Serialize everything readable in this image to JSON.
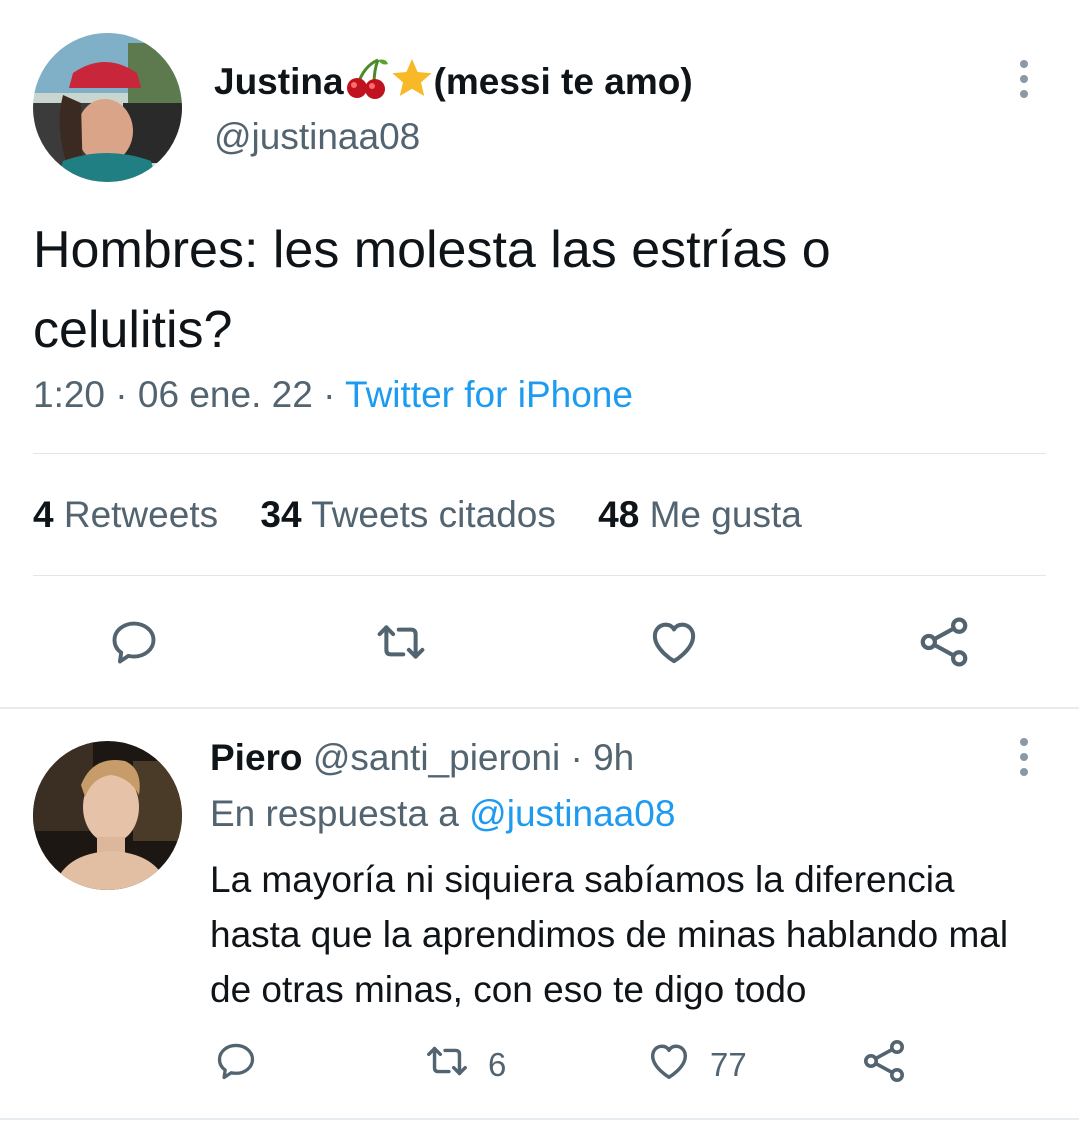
{
  "main_tweet": {
    "display_name": "Justina",
    "display_name_suffix": "(messi te amo)",
    "display_name_icons": [
      "cherries-emoji",
      "star-emoji"
    ],
    "handle": "@justinaa08",
    "text": "Hombres: les molesta las estrías o celulitis?",
    "time": "1:20",
    "date": "06 ene. 22",
    "source": "Twitter for iPhone",
    "stats": {
      "retweets_count": "4",
      "retweets_label": "Retweets",
      "quotes_count": "34",
      "quotes_label": "Tweets citados",
      "likes_count": "48",
      "likes_label": "Me gusta"
    },
    "actions": [
      "reply-icon",
      "retweet-icon",
      "like-icon",
      "share-icon"
    ]
  },
  "reply_tweet": {
    "display_name": "Piero",
    "handle": "@santi_pieroni",
    "time": "9h",
    "reply_prefix": "En respuesta a",
    "reply_mention": "@justinaa08",
    "text": "La mayoría ni siquiera sabíamos la diferencia hasta que la aprendimos de minas hablando mal de otras minas, con eso te digo todo",
    "retweets": "6",
    "likes": "77",
    "actions": [
      "reply-icon",
      "retweet-icon",
      "like-icon",
      "share-icon"
    ]
  },
  "colors": {
    "text": "#0f1419",
    "secondary": "#536471",
    "link": "#1d9bf0",
    "divider": "#e1e6ea"
  }
}
